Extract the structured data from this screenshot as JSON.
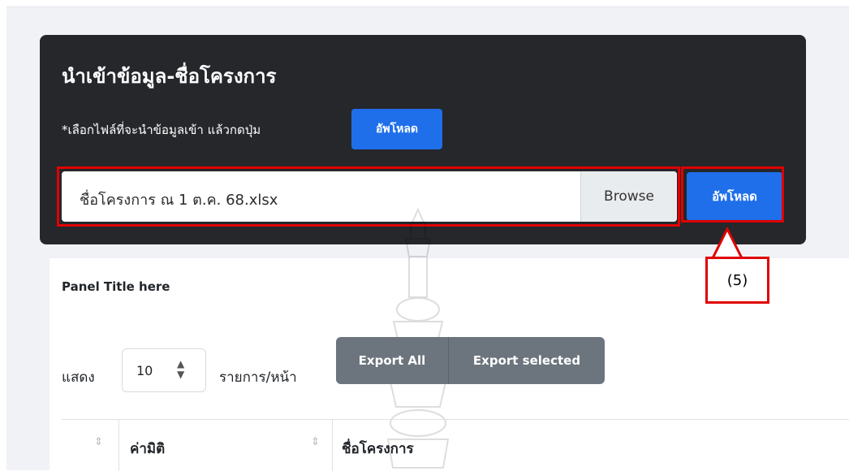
{
  "upload_card": {
    "title": "นำเข้าข้อมูล-ชื่อโครงการ",
    "hint": "*เลือกไฟล์ที่จะนำข้อมูลเข้า แล้วกดปุ่ม",
    "hint_button": "อัพโหลด",
    "file_name": "ชื่อโครงการ ณ 1 ต.ค. 68.xlsx",
    "browse_label": "Browse",
    "upload_label": "อัพโหลด"
  },
  "annotation": {
    "callout": "(5)"
  },
  "panel": {
    "title": "Panel Title here",
    "show_label": "แสดง",
    "page_length": "10",
    "per_page_label": "รายการ/หน้า",
    "export_all": "Export All",
    "export_selected": "Export selected",
    "columns": [
      "",
      "ค่ามิติ",
      "ชื่อโครงการ"
    ]
  },
  "colors": {
    "card_bg": "#25272b",
    "primary": "#1f6feb",
    "secondary": "#6c757d",
    "highlight": "#e00000"
  },
  "icons": [
    "sort-icon",
    "select-arrows-icon",
    "emblem-watermark"
  ]
}
